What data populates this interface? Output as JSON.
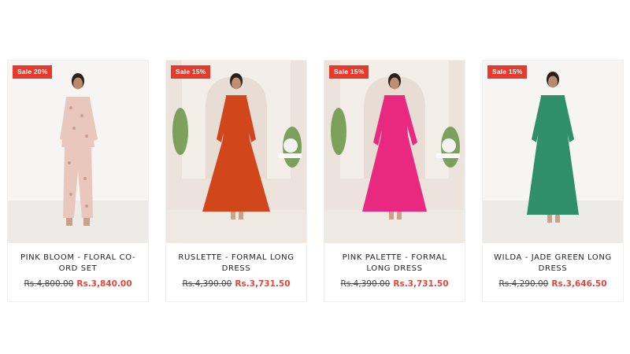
{
  "colors": {
    "sale_badge": "#e53b2f",
    "sale_price": "#e0473b",
    "old_price": "#444444"
  },
  "products": [
    {
      "badge": "Sale 20%",
      "title": "PINK BLOOM - FLORAL CO-ORD SET",
      "old_price": "Rs.4,800.00",
      "price": "Rs.3,840.00",
      "garment_color": "#e9c7bd",
      "backdrop": "plain"
    },
    {
      "badge": "Sale 15%",
      "title": "RUSLETTE - FORMAL LONG DRESS",
      "old_price": "Rs.4,390.00",
      "price": "Rs.3,731.50",
      "garment_color": "#d2461c",
      "backdrop": "arch"
    },
    {
      "badge": "Sale 15%",
      "title": "PINK PALETTE - FORMAL LONG DRESS",
      "old_price": "Rs.4,390.00",
      "price": "Rs.3,731.50",
      "garment_color": "#e9287f",
      "backdrop": "arch"
    },
    {
      "badge": "Sale 15%",
      "title": "WILDA - JADE GREEN LONG DRESS",
      "old_price": "Rs.4,290.00",
      "price": "Rs.3,646.50",
      "garment_color": "#2f8e6c",
      "backdrop": "plain"
    }
  ]
}
